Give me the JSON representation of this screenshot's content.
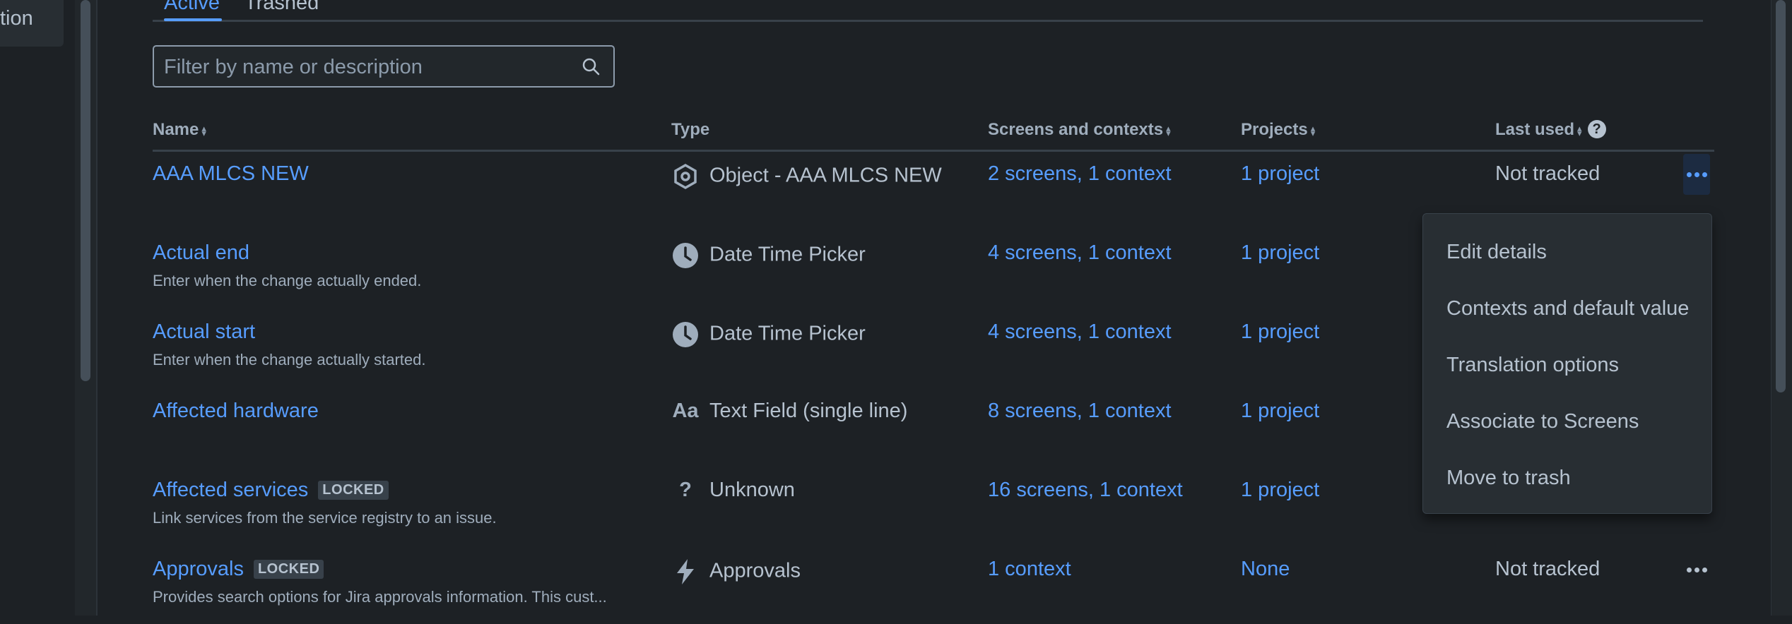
{
  "sidebar": {
    "active_item_label": "tion"
  },
  "tabs": [
    {
      "label": "Active",
      "active": true
    },
    {
      "label": "Trashed",
      "active": false
    }
  ],
  "filter": {
    "placeholder": "Filter by name or description",
    "value": ""
  },
  "table": {
    "headers": {
      "name": "Name",
      "type": "Type",
      "screens": "Screens and contexts",
      "projects": "Projects",
      "last_used": "Last used"
    },
    "rows": [
      {
        "name": "AAA MLCS NEW",
        "locked": false,
        "description": "",
        "type_icon": "object-icon",
        "type": "Object - AAA MLCS NEW",
        "screens": "2 screens, 1 context",
        "projects": "1 project",
        "last_used": "Not tracked"
      },
      {
        "name": "Actual end",
        "locked": false,
        "description": "Enter when the change actually ended.",
        "type_icon": "clock-icon",
        "type": "Date Time Picker",
        "screens": "4 screens, 1 context",
        "projects": "1 project",
        "last_used": ""
      },
      {
        "name": "Actual start",
        "locked": false,
        "description": "Enter when the change actually started.",
        "type_icon": "clock-icon",
        "type": "Date Time Picker",
        "screens": "4 screens, 1 context",
        "projects": "1 project",
        "last_used": ""
      },
      {
        "name": "Affected hardware",
        "locked": false,
        "description": "",
        "type_icon": "text-field-icon",
        "type": "Text Field (single line)",
        "screens": "8 screens, 1 context",
        "projects": "1 project",
        "last_used": ""
      },
      {
        "name": "Affected services",
        "locked": true,
        "description": "Link services from the service registry to an issue.",
        "type_icon": "question-icon",
        "type": "Unknown",
        "screens": "16 screens, 1 context",
        "projects": "1 project",
        "last_used": ""
      },
      {
        "name": "Approvals",
        "locked": true,
        "description": "Provides search options for Jira approvals information. This cust...",
        "type_icon": "lightning-icon",
        "type": "Approvals",
        "screens": "1 context",
        "projects": "None",
        "last_used": "Not tracked"
      }
    ],
    "locked_badge": "LOCKED",
    "type_glyphs": {
      "text": "Aa",
      "question": "?"
    }
  },
  "menu": {
    "items": [
      "Edit details",
      "Contexts and default value",
      "Translation options",
      "Associate to Screens",
      "Move to trash"
    ]
  },
  "colors": {
    "background": "#1d2125",
    "link": "#579dff",
    "text": "#b6c2cf",
    "subtle_text": "#9fadbc",
    "menu_bg": "#282e33"
  }
}
